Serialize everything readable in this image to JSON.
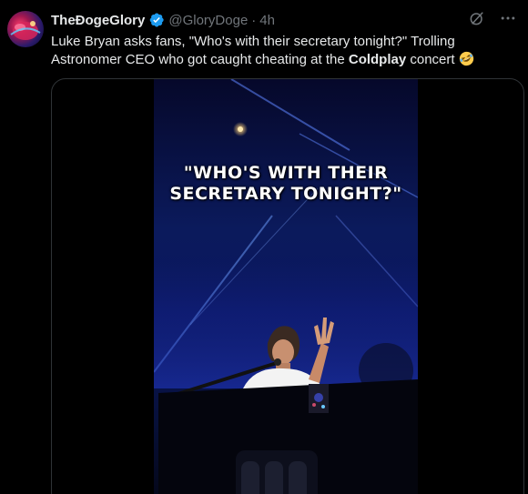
{
  "tweet": {
    "display_name": "TheĐogeGlory",
    "handle": "@GloryDoge",
    "separator": "·",
    "time": "4h",
    "text_before": "Luke Bryan asks fans, \"Who's with their secretary tonight?\" Trolling Astronomer CEO who got caught cheating at the ",
    "text_bold": "Coldplay",
    "text_after": " concert",
    "emoji_icon": "rolling-on-floor-laughing-emoji"
  },
  "video": {
    "caption_line1": "\"WHO'S WITH THEIR",
    "caption_line2": "SECRETARY TONIGHT?\""
  },
  "colors": {
    "verified": "#1d9bf0",
    "muted": "#71767b",
    "text": "#e7e9ea",
    "border": "#2f3336"
  }
}
